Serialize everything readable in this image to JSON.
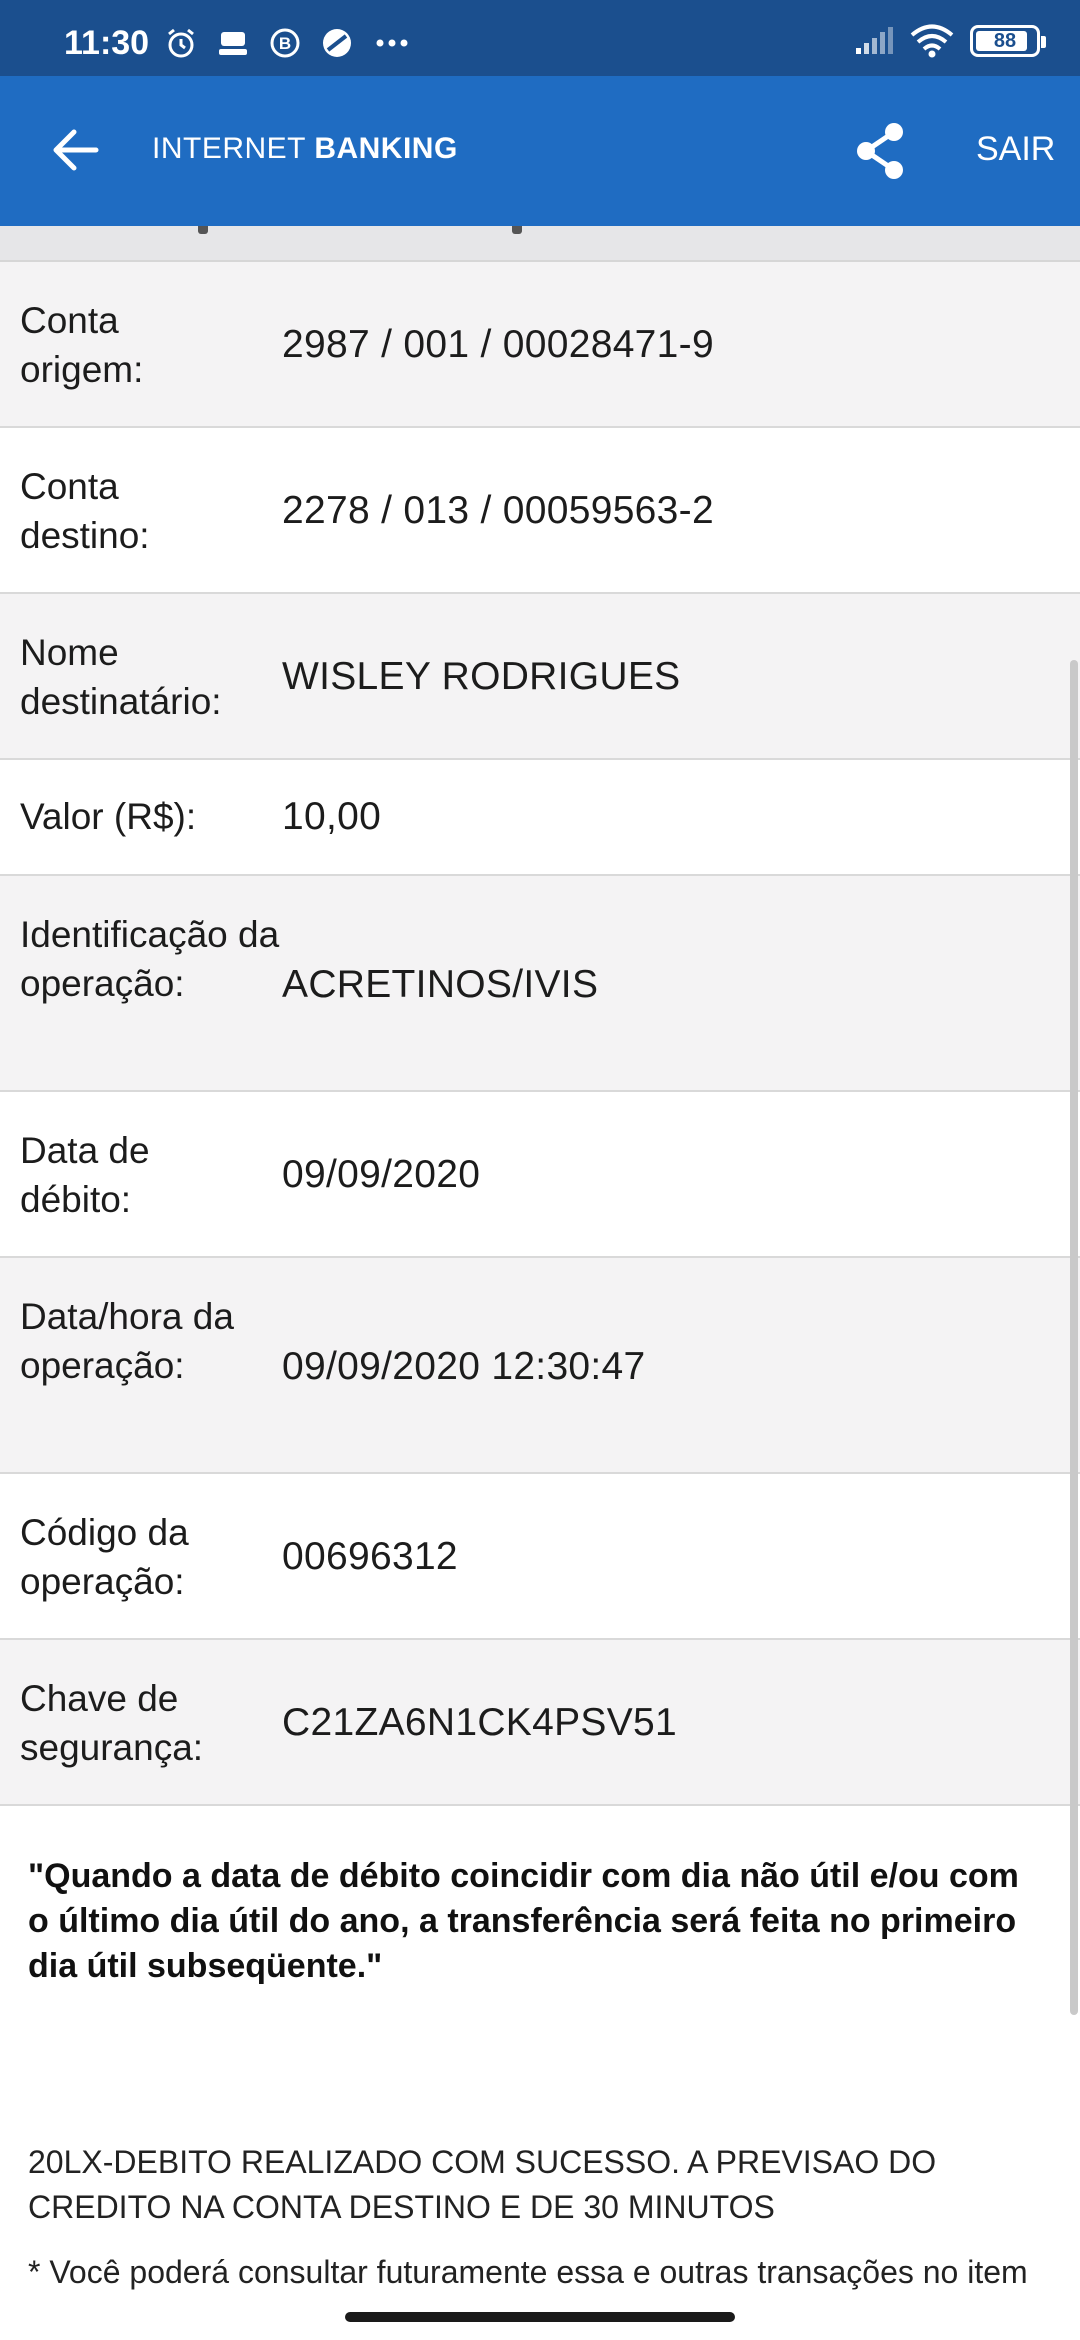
{
  "status_bar": {
    "time": "11:30",
    "left_icons": [
      "alarm-icon",
      "storage-icon",
      "b-app-icon",
      "dnd-icon",
      "more-dots-icon"
    ],
    "right_icons": [
      "signal-icon",
      "wifi-icon"
    ],
    "battery": "88"
  },
  "app_bar": {
    "title_light": "INTERNET",
    "title_bold": "BANKING",
    "exit_label": "SAIR",
    "color": "#1f6cc2",
    "status_color": "#1b4f8e"
  },
  "details": [
    {
      "label": "Conta origem:",
      "value": "2987 / 001 / 00028471-9"
    },
    {
      "label": "Conta destino:",
      "value": "2278 / 013 / 00059563-2"
    },
    {
      "label": "Nome destinatário:",
      "value": "WISLEY RODRIGUES"
    },
    {
      "label": "Valor (R$):",
      "value": "10,00"
    },
    {
      "label": "Identificação da operação:",
      "value": "ACRETINOS/IVIS"
    },
    {
      "label": "Data de débito:",
      "value": "09/09/2020"
    },
    {
      "label": "Data/hora da operação:",
      "value": "09/09/2020 12:30:47"
    },
    {
      "label": "Código da operação:",
      "value": "00696312"
    },
    {
      "label": "Chave de segurança:",
      "value": "C21ZA6N1CK4PSV51"
    }
  ],
  "notice": "\"Quando a data de débito coincidir com dia não útil e/ou com o último dia útil do ano, a transferência será feita no primeiro dia útil subseqüente.\"",
  "status_message": "20LX-DEBITO REALIZADO COM SUCESSO. A PREVISAO DO CREDITO NA CONTA DESTINO E DE 30 MINUTOS",
  "footnote": "* Você poderá consultar futuramente essa e outras transações no item"
}
